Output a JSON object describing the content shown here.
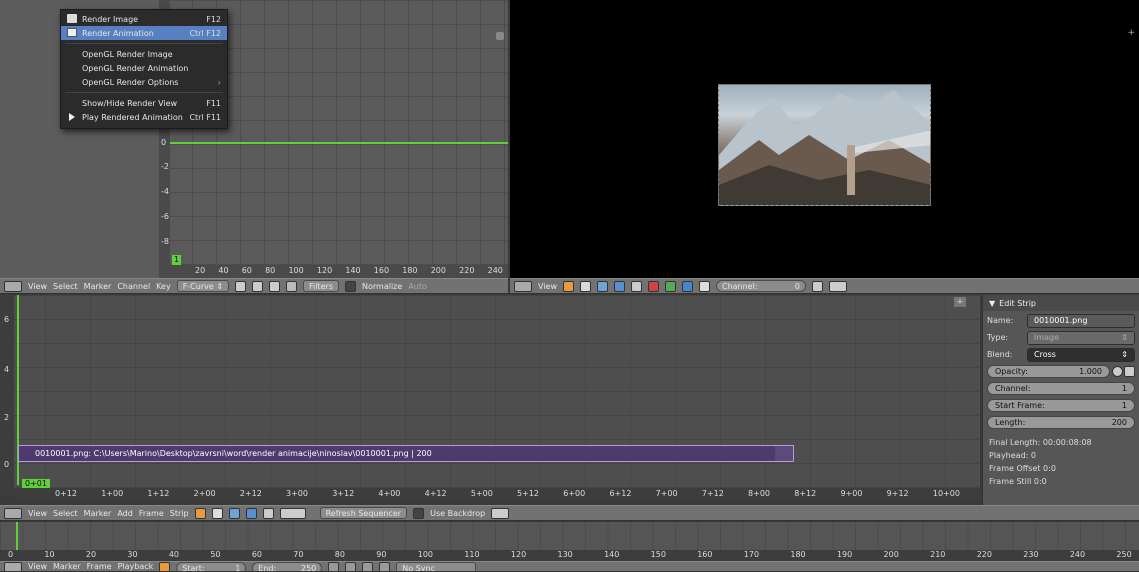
{
  "render_menu": {
    "items": [
      {
        "label": "Render Image",
        "shortcut": "F12",
        "icon": "render-image-icon",
        "highlighted": false
      },
      {
        "label": "Render Animation",
        "shortcut": "Ctrl F12",
        "icon": "render-animation-icon",
        "highlighted": true
      },
      {
        "label": "OpenGL Render Image",
        "shortcut": "",
        "icon": ""
      },
      {
        "label": "OpenGL Render Animation",
        "shortcut": "",
        "icon": ""
      },
      {
        "label": "OpenGL Render Options",
        "shortcut": "",
        "submenu": true
      },
      {
        "label": "Show/Hide Render View",
        "shortcut": "F11",
        "icon": ""
      },
      {
        "label": "Play Rendered Animation",
        "shortcut": "Ctrl F11",
        "icon": "play-icon"
      }
    ]
  },
  "graph_editor": {
    "current_frame_badge": "1",
    "x_ticks": [
      "20",
      "40",
      "60",
      "80",
      "100",
      "120",
      "140",
      "160",
      "180",
      "200",
      "220",
      "240"
    ],
    "y_ticks": [
      "0",
      "-2",
      "-4",
      "-6",
      "-8"
    ],
    "header": {
      "menus": [
        "View",
        "Select",
        "Marker",
        "Channel",
        "Key"
      ],
      "mode": "F-Curve",
      "filters_label": "Filters",
      "normalize_label": "Normalize",
      "auto_label": "Auto"
    }
  },
  "preview_header": {
    "view_label": "View",
    "channel_label": "Channel:",
    "channel_value": "0"
  },
  "sequencer": {
    "strip_label": "0010001.png: C:\\Users\\Marino\\Desktop\\zavrsni\\word\\render animacije\\ninoslav\\0010001.png | 200",
    "current_frame_badge": "0+01",
    "time_ticks": [
      "0+12",
      "1+00",
      "1+12",
      "2+00",
      "2+12",
      "3+00",
      "3+12",
      "4+00",
      "4+12",
      "5+00",
      "5+12",
      "6+00",
      "6+12",
      "7+00",
      "7+12",
      "8+00",
      "8+12",
      "9+00",
      "9+12",
      "10+00"
    ],
    "channel_ticks": [
      "6",
      "4",
      "2",
      "0"
    ],
    "header": {
      "menus": [
        "View",
        "Select",
        "Marker",
        "Add",
        "Frame",
        "Strip"
      ],
      "refresh_label": "Refresh Sequencer",
      "backdrop_label": "Use Backdrop"
    }
  },
  "edit_strip": {
    "title": "Edit Strip",
    "name_label": "Name:",
    "name_value": "0010001.png",
    "type_label": "Type:",
    "type_value": "Image",
    "blend_label": "Blend:",
    "blend_value": "Cross",
    "opacity_label": "Opacity:",
    "opacity_value": "1.000",
    "channel_label": "Channel:",
    "channel_value": "1",
    "start_label": "Start Frame:",
    "start_value": "1",
    "length_label": "Length:",
    "length_value": "200",
    "final_length": "Final Length: 00:00:08:08",
    "playhead": "Playhead: 0",
    "frame_offset": "Frame Offset 0:0",
    "frame_still": "Frame Still 0:0"
  },
  "timeline": {
    "ticks": [
      "0",
      "10",
      "20",
      "30",
      "40",
      "50",
      "60",
      "70",
      "80",
      "90",
      "100",
      "110",
      "120",
      "130",
      "140",
      "150",
      "160",
      "170",
      "180",
      "190",
      "200",
      "210",
      "220",
      "230",
      "240",
      "250"
    ],
    "footer_menus": [
      "View",
      "Marker",
      "Frame",
      "Playback"
    ],
    "start_label": "Start:",
    "start_value": "1",
    "end_label": "End:",
    "end_value": "250",
    "keying_label": "No Sync"
  }
}
